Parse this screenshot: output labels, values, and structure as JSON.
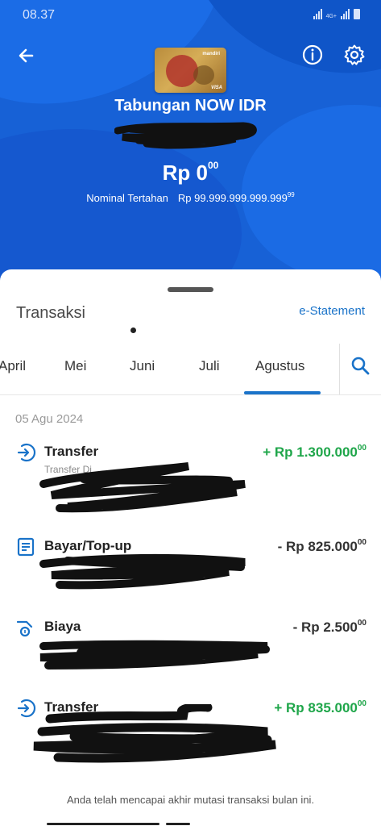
{
  "status_bar": {
    "time": "08.37",
    "network": "4G+"
  },
  "header": {
    "card_brand": "mandiri",
    "card_network": "VISA",
    "account_name": "Tabungan NOW IDR",
    "balance_main": "Rp 0",
    "balance_cents": "00",
    "held_label": "Nominal Tertahan",
    "held_value": "Rp 99.999.999.999.999",
    "held_cents": "99",
    "icons": {
      "back": "arrow-left-icon",
      "info": "info-icon",
      "settings": "gear-icon"
    }
  },
  "sheet": {
    "title": "Transaksi",
    "estatement_label": "e-Statement",
    "tabs": [
      {
        "label": "April"
      },
      {
        "label": "Mei"
      },
      {
        "label": "Juni"
      },
      {
        "label": "Juli"
      },
      {
        "label": "Agustus",
        "active": true
      }
    ],
    "date_header": "05 Agu 2024",
    "transactions": [
      {
        "icon": "transfer-icon",
        "title": "Transfer",
        "amount": "+ Rp 1.300.000",
        "cents": "00",
        "direction": "in",
        "subtitle": "Transfer Di"
      },
      {
        "icon": "bill-icon",
        "title": "Bayar/Top-up",
        "amount": "- Rp 825.000",
        "cents": "00",
        "direction": "out",
        "subtitle": ""
      },
      {
        "icon": "fee-icon",
        "title": "Biaya",
        "amount": "- Rp 2.500",
        "cents": "00",
        "direction": "out",
        "subtitle": ""
      },
      {
        "icon": "transfer-icon",
        "title": "Transfer",
        "amount": "+ Rp 835.000",
        "cents": "00",
        "direction": "in",
        "subtitle": ""
      }
    ],
    "footer_note": "Anda telah mencapai akhir mutasi transaksi bulan ini."
  },
  "colors": {
    "header_blue": "#1761d6",
    "accent_blue": "#1a73c9",
    "credit_green": "#1fa64a"
  }
}
